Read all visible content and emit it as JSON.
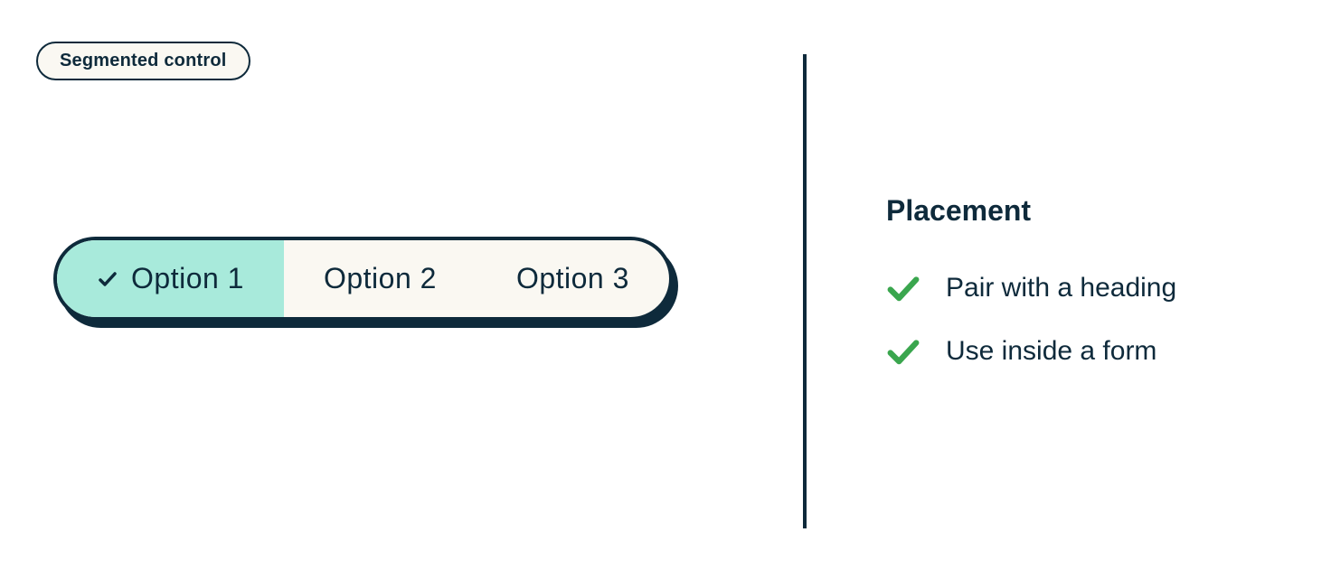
{
  "badge": {
    "label": "Segmented control"
  },
  "segmented": {
    "options": [
      {
        "label": "Option 1",
        "selected": true
      },
      {
        "label": "Option 2",
        "selected": false
      },
      {
        "label": "Option 3",
        "selected": false
      }
    ]
  },
  "info": {
    "heading": "Placement",
    "items": [
      {
        "text": "Pair with a heading"
      },
      {
        "text": "Use inside a form"
      }
    ]
  },
  "colors": {
    "ink": "#0e2a3b",
    "cream": "#faf8f2",
    "mint": "#a8eadb",
    "green": "#3aa64e"
  }
}
